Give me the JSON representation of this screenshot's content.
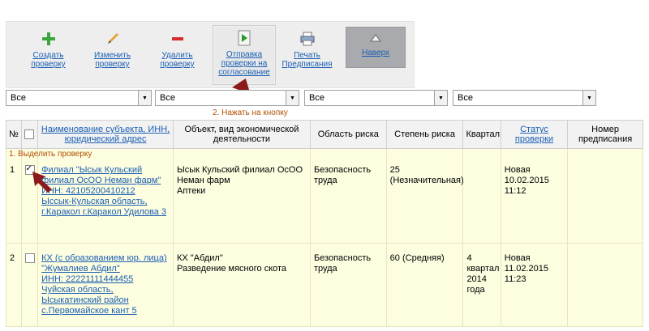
{
  "toolbar": {
    "create": "Создать проверку",
    "edit": "Изменить проверку",
    "delete": "Удалить проверку",
    "send": "Отправка проверки на согласование",
    "print": "Печать Предписания",
    "top": "Наверх"
  },
  "filters": [
    "Все",
    "Все",
    "Все",
    "Все"
  ],
  "annotations": {
    "step2": "2. Нажать на кнопку",
    "step1": "1. Выделить проверку"
  },
  "table": {
    "headers": {
      "num": "№",
      "name": "Наименование субъекта, ИНН, юридический адрес",
      "object": "Объект, вид экономической деятельности",
      "risk_area": "Область риска",
      "risk_degree": "Степень риска",
      "quarter": "Квартал",
      "status": "Статус проверки",
      "order": "Номер предписания"
    },
    "rows": [
      {
        "num": "1",
        "name_l1": "Филиал \"Ысык Кульский",
        "name_l2": "филиал ОсОО Неман фарм\"",
        "name_l3": "ИНН: 42105200410212",
        "name_l4": "Ыссык-Кульская область,",
        "name_l5": "г.Каракол г.Каракол Удилова 3",
        "obj_l1": "Ысык Кульский филиал ОсОО",
        "obj_l2": "Неман фарм",
        "obj_l3": "Аптеки",
        "risk_l1": "Безопасность",
        "risk_l2": "труда",
        "degree_l1": "25",
        "degree_l2": "(Незначительная)",
        "quarter_l1": "",
        "quarter_l2": "",
        "quarter_l3": "",
        "status_l1": "Новая",
        "status_l2": "10.02.2015",
        "status_l3": "11:12",
        "order": ""
      },
      {
        "num": "2",
        "name_l1": "КХ (с образованием юр. лица)",
        "name_l2": "\"Жумалиев Абдил\"",
        "name_l3": "ИНН: 22221111444455",
        "name_l4": "Чуйская область,",
        "name_l5": "Ысыкатинский район",
        "name_l6": "с.Первомайское кант 5",
        "obj_l1": "КХ \"Абдил\"",
        "obj_l2": "Разведение мясного скота",
        "risk_l1": "Безопасность",
        "risk_l2": "труда",
        "degree_l1": "60 (Средняя)",
        "quarter_l1": "4",
        "quarter_l2": "квартал",
        "quarter_l3": "2014",
        "quarter_l4": "года",
        "status_l1": "Новая",
        "status_l2": "11.02.2015",
        "status_l3": "11:23",
        "order": ""
      }
    ]
  },
  "colors": {
    "link": "#1a5fb4",
    "row_bg": "#fdfde0",
    "annotation": "#b25000",
    "arrow": "#8b1a1a"
  }
}
